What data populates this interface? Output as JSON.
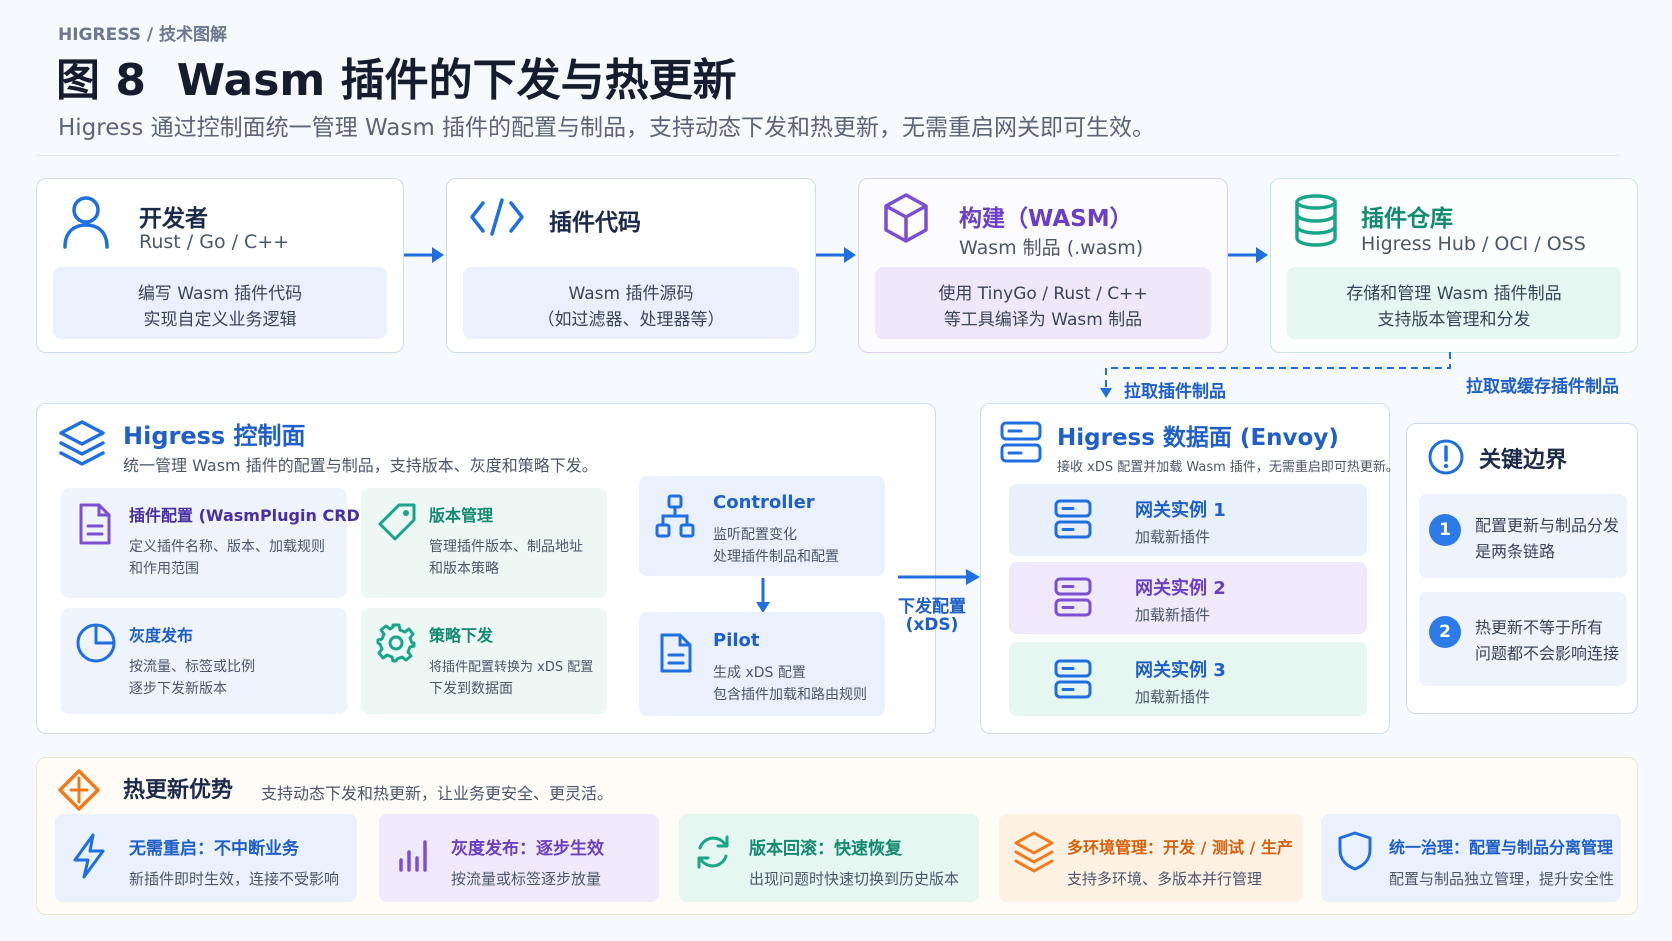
{
  "header": {
    "breadcrumb_brand": "HIGRESS",
    "breadcrumb_sep": "/",
    "breadcrumb_section": "技术图解",
    "title": "图 8  Wasm 插件的下发与热更新",
    "subtitle": "Higress 通过控制面统一管理 Wasm 插件的配置与制品，支持动态下发和热更新，无需重启网关即可生效。"
  },
  "flow": [
    {
      "title": "开发者",
      "subtitle": "Rust / Go / C++",
      "desc1": "编写 Wasm 插件代码",
      "desc2": "实现自定义业务逻辑",
      "icon": "user-icon"
    },
    {
      "title": "插件代码",
      "subtitle": "",
      "desc1": "Wasm 插件源码",
      "desc2": "（如过滤器、处理器等）",
      "icon": "code-icon"
    },
    {
      "title": "构建（WASM）",
      "subtitle": "Wasm 制品 (.wasm)",
      "desc1": "使用 TinyGo / Rust / C++",
      "desc2": "等工具编译为 Wasm 制品",
      "icon": "cube-icon"
    },
    {
      "title": "插件仓库",
      "subtitle": "Higress Hub / OCI / OSS",
      "desc1": "存储和管理 Wasm 插件制品",
      "desc2": "支持版本管理和分发",
      "icon": "database-icon"
    }
  ],
  "labels": {
    "pull_artifact": "拉取插件制品",
    "pull_or_cache": "拉取或缓存插件制品",
    "dispatch_line1": "下发配置",
    "dispatch_line2": "(xDS)"
  },
  "control_plane": {
    "title": "Higress 控制面",
    "desc": "统一管理 Wasm 插件的配置与制品，支持版本、灰度和策略下发。",
    "features": [
      {
        "title": "插件配置 (WasmPlugin CRD)",
        "line1": "定义插件名称、版本、加载规则",
        "line2": "和作用范围",
        "icon": "document-icon"
      },
      {
        "title": "版本管理",
        "line1": "管理插件版本、制品地址",
        "line2": "和版本策略",
        "icon": "tag-icon"
      },
      {
        "title": "灰度发布",
        "line1": "按流量、标签或比例",
        "line2": "逐步下发新版本",
        "icon": "pie-chart-icon"
      },
      {
        "title": "策略下发",
        "line1": "将插件配置转换为 xDS 配置",
        "line2": "下发到数据面",
        "icon": "gear-icon"
      }
    ],
    "controller": {
      "title": "Controller",
      "line1": "监听配置变化",
      "line2": "处理插件制品和配置"
    },
    "pilot": {
      "title": "Pilot",
      "line1": "生成 xDS 配置",
      "line2": "包含插件加载和路由规则"
    }
  },
  "data_plane": {
    "title": "Higress 数据面 (Envoy)",
    "desc": "接收 xDS 配置并加载 Wasm 插件，无需重启即可热更新。",
    "instances": [
      {
        "title": "网关实例 1",
        "desc": "加载新插件"
      },
      {
        "title": "网关实例 2",
        "desc": "加载新插件"
      },
      {
        "title": "网关实例 3",
        "desc": "加载新插件"
      }
    ]
  },
  "boundary": {
    "title": "关键边界",
    "items": [
      {
        "num": "1",
        "line1": "配置更新与制品分发",
        "line2": "是两条链路"
      },
      {
        "num": "2",
        "line1": "热更新不等于所有",
        "line2": "问题都不会影响连接"
      }
    ]
  },
  "advantages": {
    "title": "热更新优势",
    "desc": "支持动态下发和热更新，让业务更安全、更灵活。",
    "items": [
      {
        "title": "无需重启：不中断业务",
        "desc": "新插件即时生效，连接不受影响",
        "icon": "lightning-icon"
      },
      {
        "title": "灰度发布：逐步生效",
        "desc": "按流量或标签逐步放量",
        "icon": "bar-chart-icon"
      },
      {
        "title": "版本回滚：快速恢复",
        "desc": "出现问题时快速切换到历史版本",
        "icon": "refresh-icon"
      },
      {
        "title": "多环境管理：开发 / 测试 / 生产",
        "desc": "支持多环境、多版本并行管理",
        "icon": "layers-icon"
      },
      {
        "title": "统一治理：配置与制品分离管理",
        "desc": "配置与制品独立管理，提升安全性",
        "icon": "shield-icon"
      }
    ]
  },
  "colors": {
    "blue": "#1f6fe0",
    "purple": "#7b4fd0",
    "green": "#18a58a",
    "orange": "#f07a1a",
    "navy": "#1c2a4a"
  }
}
